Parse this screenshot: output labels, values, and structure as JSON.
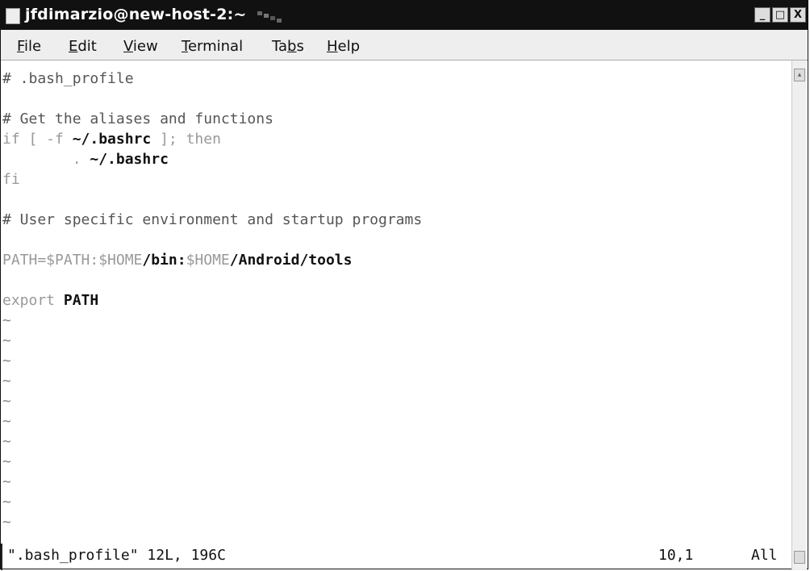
{
  "window": {
    "title": "jfdimarzio@new-host-2:~",
    "controls": [
      "_",
      "□",
      "X"
    ]
  },
  "menu": {
    "items": [
      {
        "label": "File",
        "mnemonic": "F"
      },
      {
        "label": "Edit",
        "mnemonic": "E"
      },
      {
        "label": "View",
        "mnemonic": "V"
      },
      {
        "label": "Terminal",
        "mnemonic": "T"
      },
      {
        "label": "Tabs",
        "mnemonic": "b"
      },
      {
        "label": "Help",
        "mnemonic": "H"
      }
    ]
  },
  "editor": {
    "lines": [
      "# .bash_profile",
      "",
      "# Get the aliases and functions",
      "if [ -f ~/.bashrc ]; then",
      "        . ~/.bashrc",
      "fi",
      "",
      "# User specific environment and startup programs",
      "",
      "PATH=$PATH:$HOME/bin:$HOME/Android/tools",
      "",
      "export PATH"
    ],
    "empty_marker": "~",
    "empty_count": 11
  },
  "statusline": {
    "file_info": "\".bash_profile\" 12L, 196C",
    "cursor_position": "10,1",
    "scroll_position": "All"
  },
  "icons": {
    "terminal": "terminal-icon",
    "minimize": "minimize-icon",
    "maximize": "maximize-icon",
    "close": "close-icon"
  }
}
